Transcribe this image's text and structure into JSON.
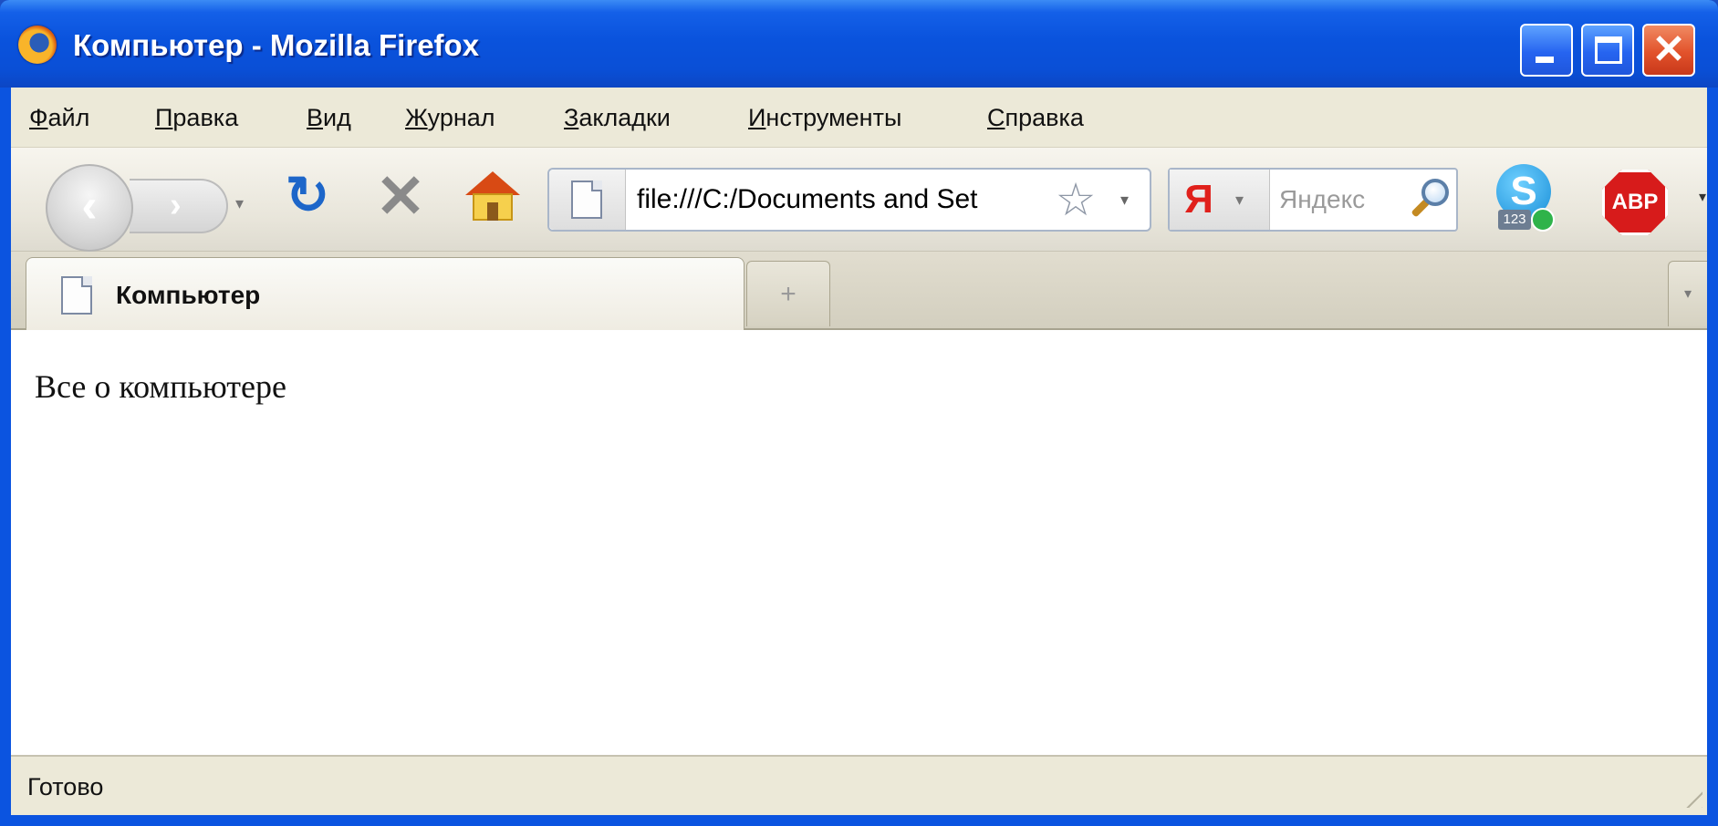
{
  "window": {
    "title": "Компьютер - Mozilla Firefox",
    "buttons": {
      "minimize": "minimize",
      "maximize": "maximize",
      "close": "✕"
    }
  },
  "menu": {
    "items": [
      {
        "underline": "Ф",
        "rest": "айл"
      },
      {
        "underline": "П",
        "rest": "равка"
      },
      {
        "underline": "В",
        "rest": "ид"
      },
      {
        "underline": "Ж",
        "rest": "урнал"
      },
      {
        "underline": "З",
        "rest": "акладки"
      },
      {
        "underline": "И",
        "rest": "нструменты"
      },
      {
        "underline": "С",
        "rest": "правка"
      }
    ]
  },
  "toolbar": {
    "back_glyph": "‹",
    "forward_glyph": "›",
    "reload_glyph": "↻",
    "stop_glyph": "✕",
    "url": "file:///C:/Documents and Set",
    "bookmark_star": "☆",
    "search_engine_letter": "Я",
    "search_placeholder": "Яндекс",
    "skype_letter": "S",
    "skype_badge": "123",
    "abp_label": "ABP"
  },
  "tabs": [
    {
      "label": "Компьютер",
      "active": true
    }
  ],
  "tabstrip": {
    "new_tab_glyph": "+",
    "list_all_glyph": "▾"
  },
  "content": {
    "text": "Все о компьютере"
  },
  "status": {
    "text": "Готово"
  },
  "colors": {
    "titlebar": "#0a53dd",
    "chrome": "#ece9d8",
    "close_button": "#e2522b",
    "reload": "#1d66c9",
    "abp": "#d71b1b",
    "yandex": "#e0201b"
  },
  "icons": [
    "firefox-icon",
    "back-icon",
    "forward-icon",
    "reload-icon",
    "stop-icon",
    "home-icon",
    "page-icon",
    "bookmark-star-icon",
    "yandex-icon",
    "search-icon",
    "skype-icon",
    "adblock-plus-icon"
  ]
}
